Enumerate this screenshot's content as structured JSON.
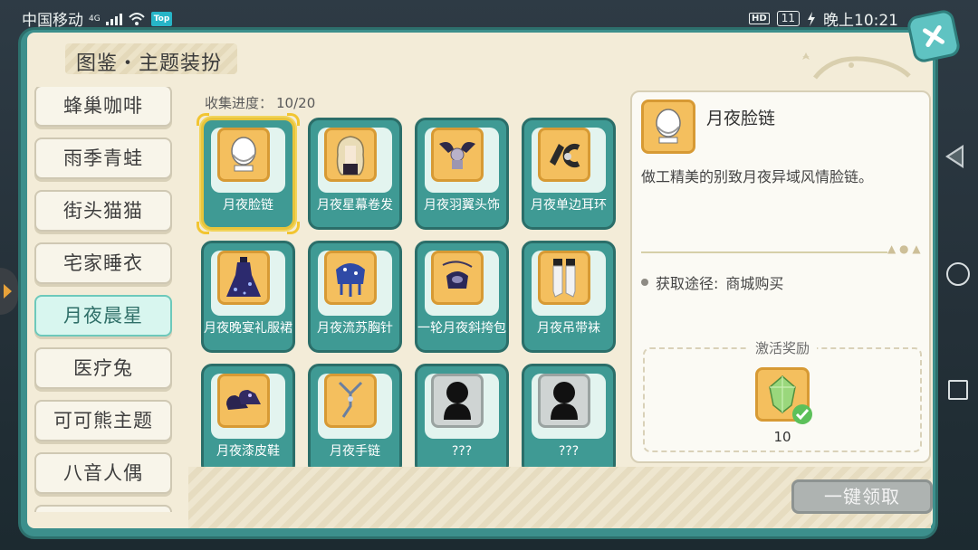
{
  "status": {
    "carrier": "中国移动",
    "network": "4G",
    "app_badge": "Top",
    "hd": "HD",
    "battery": "11",
    "time": "晚上10:21"
  },
  "header": {
    "title": "图鉴・主题装扮"
  },
  "sidebar": {
    "items": [
      {
        "label": "蜂巢咖啡",
        "active": false
      },
      {
        "label": "雨季青蛙",
        "active": false
      },
      {
        "label": "街头猫猫",
        "active": false
      },
      {
        "label": "宅家睡衣",
        "active": false
      },
      {
        "label": "月夜晨星",
        "active": true
      },
      {
        "label": "医疗兔",
        "active": false
      },
      {
        "label": "可可熊主题",
        "active": false
      },
      {
        "label": "八音人偶",
        "active": false
      }
    ]
  },
  "collection": {
    "progress_label": "收集进度：",
    "progress_value": "10/20",
    "items": [
      {
        "label": "月夜脸链",
        "icon": "face-chain-icon",
        "selected": true,
        "locked": false
      },
      {
        "label": "月夜星幕卷发",
        "icon": "curly-hair-icon",
        "selected": false,
        "locked": false
      },
      {
        "label": "月夜羽翼头饰",
        "icon": "wing-headwear-icon",
        "selected": false,
        "locked": false
      },
      {
        "label": "月夜单边耳环",
        "icon": "earring-icon",
        "selected": false,
        "locked": false
      },
      {
        "label": "月夜晚宴礼服裙",
        "icon": "gown-icon",
        "selected": false,
        "locked": false
      },
      {
        "label": "月夜流苏胸针",
        "icon": "brooch-icon",
        "selected": false,
        "locked": false
      },
      {
        "label": "一轮月夜斜挎包",
        "icon": "crossbody-bag-icon",
        "selected": false,
        "locked": false
      },
      {
        "label": "月夜吊带袜",
        "icon": "stockings-icon",
        "selected": false,
        "locked": false
      },
      {
        "label": "月夜漆皮鞋",
        "icon": "shoes-icon",
        "selected": false,
        "locked": false
      },
      {
        "label": "月夜手链",
        "icon": "bracelet-icon",
        "selected": false,
        "locked": false
      },
      {
        "label": "???",
        "icon": "locked-silhouette-icon",
        "selected": false,
        "locked": true
      },
      {
        "label": "???",
        "icon": "locked-silhouette-icon",
        "selected": false,
        "locked": true
      }
    ]
  },
  "detail": {
    "name": "月夜脸链",
    "description": "做工精美的别致月夜异域风情脸链。",
    "source_label": "获取途径:",
    "source_value": "商城购买",
    "reward_title": "激活奖励",
    "reward_count": "10",
    "reward_icon": "green-crystal-icon"
  },
  "actions": {
    "collect_all": "一键领取"
  },
  "colors": {
    "panel_teal": "#3c8f8c",
    "slot_orange": "#f4bf5e",
    "paper": "#f3ecd8",
    "active_tab": "#d8f6ef",
    "selected_border": "#f2c531"
  }
}
